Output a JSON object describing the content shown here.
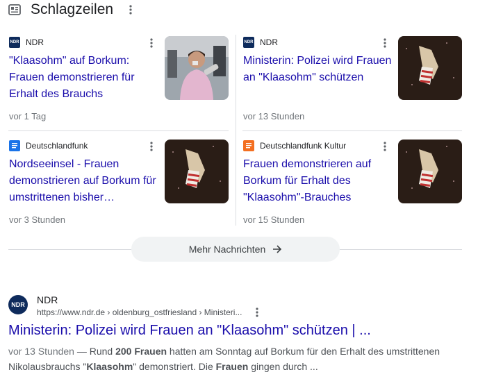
{
  "header": {
    "title": "Schlagzeilen"
  },
  "cards": [
    {
      "source": "NDR",
      "logo_text": "NDR",
      "logo_color": "#0e2b5c",
      "title": "\"Klaasohm\" auf Borkum: Frauen demonstrieren für Erhalt des Brauchs",
      "time": "vor 1 Tag"
    },
    {
      "source": "NDR",
      "logo_text": "NDR",
      "logo_color": "#0e2b5c",
      "title": "Ministerin: Polizei wird Frauen an \"Klaasohm\" schützen",
      "time": "vor 13 Stunden"
    },
    {
      "source": "Deutschlandfunk",
      "logo_text": "",
      "logo_color": "#1a73e8",
      "title": "Nordseeinsel - Frauen demonstrieren auf Borkum für umstrittenen bisher…",
      "time": "vor 3 Stunden"
    },
    {
      "source": "Deutschlandfunk Kultur",
      "logo_text": "",
      "logo_color": "#f36f21",
      "title": "Frauen demonstrieren auf Borkum für Erhalt des \"Klaasohm\"-Brauches",
      "time": "vor 15 Stunden"
    }
  ],
  "more": {
    "label": "Mehr Nachrichten"
  },
  "result": {
    "logo_text": "NDR",
    "site": "NDR",
    "url": "https://www.ndr.de › oldenburg_ostfriesland › Ministeri...",
    "title": "Ministerin: Polizei wird Frauen an \"Klaasohm\" schützen | ...",
    "date": "vor 13 Stunden",
    "sep": " — Rund ",
    "b1": "200 Frauen",
    "t2": " hatten am Sonntag auf Borkum für den Erhalt des umstrittenen Nikolausbrauchs \"",
    "b2": "Klaasohm",
    "t3": "\" demonstriert. Die ",
    "b3": "Frauen",
    "t4": " gingen durch ..."
  }
}
